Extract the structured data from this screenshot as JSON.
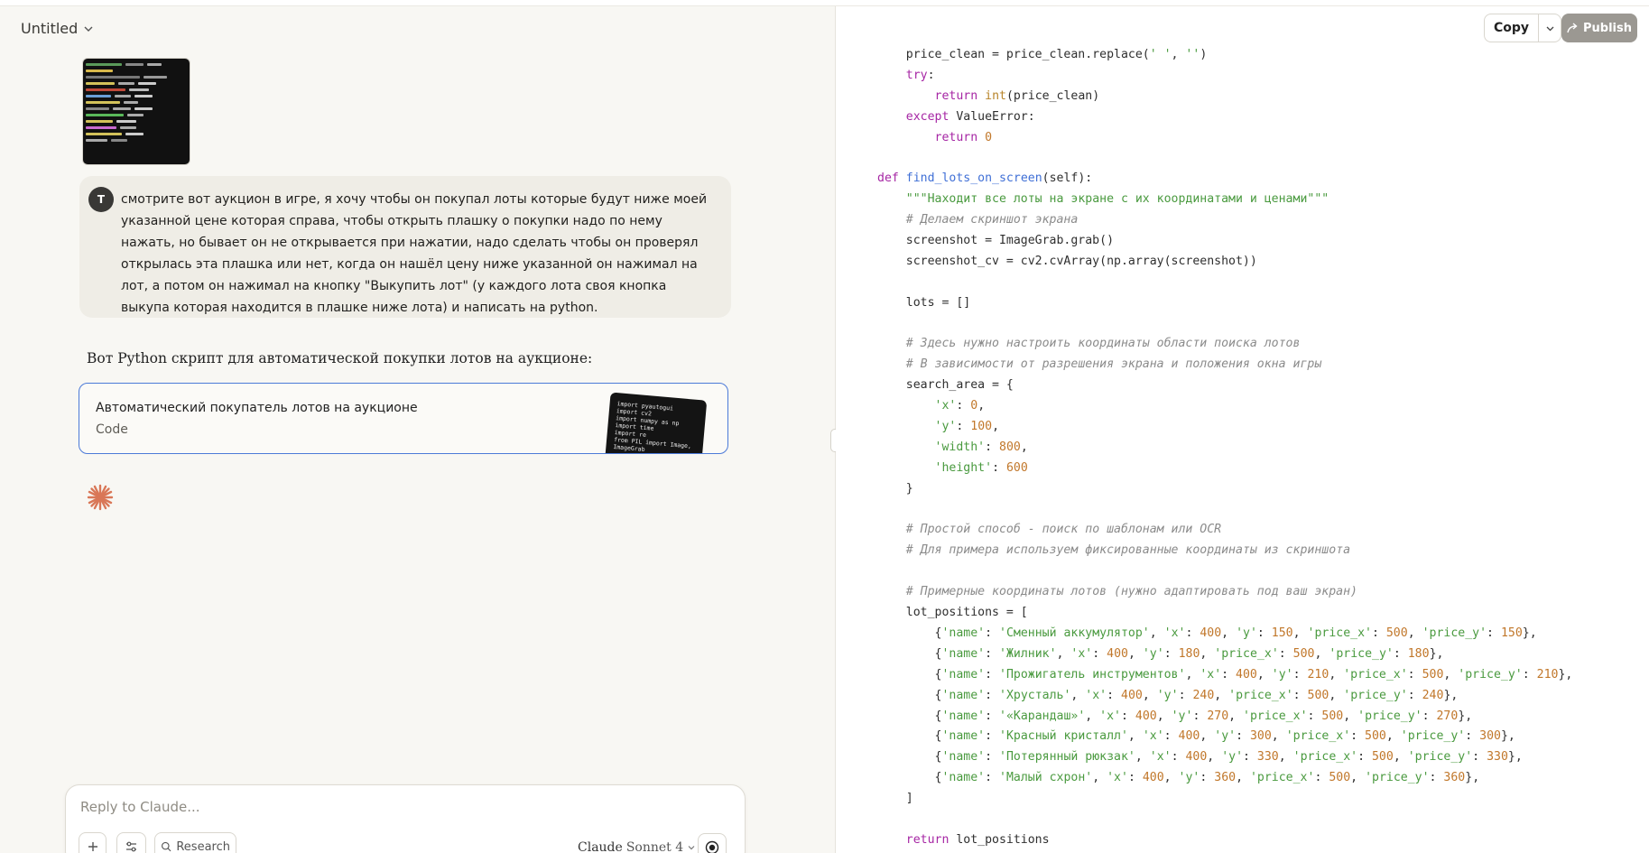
{
  "window": {
    "title": "Untitled"
  },
  "chat": {
    "user_initial": "T",
    "user_message": "смотрите вот аукцион в игре, я хочу чтобы он покупал лоты которые будут ниже моей указанной цене которая справа, чтобы открыть плашку о покупки надо по нему нажать, но бывает он не открывается при нажатии, надо сделать чтобы он проверял открылась эта плашка или нет, когда он нашёл цену ниже указанной он нажимал на лот, а потом он нажимал на кнопку \"Выкупить лот\" (у каждого лота своя кнопка выкупа которая находится в плашке ниже лота) и написать на python.",
    "assistant_intro": "Вот Python скрипт для автоматической покупки лотов на аукционе:",
    "artifact": {
      "title": "Автоматический покупатель лотов на аукционе",
      "type": "Code",
      "preview": "import pyautogui\nimport cv2\nimport numpy as np\nimport time\nimport re\nfrom PIL import Image,\nImageGrab\n\nclass AuctionBot:\n    def __init__"
    }
  },
  "composer": {
    "placeholder": "Reply to Claude...",
    "research_label": "Research",
    "model_name": "Claude",
    "model_version": "Sonnet 4"
  },
  "artifact_panel": {
    "copy_label": "Copy",
    "publish_label": "Publish"
  },
  "icons": {
    "title_caret": "chevron-down-icon",
    "plus": "plus-icon",
    "tune": "sliders-icon",
    "research": "search-icon",
    "send": "record-icon",
    "publish": "share-icon",
    "spark": "claude-spark-icon"
  },
  "colors": {
    "artifact_border": "#4c7ad8",
    "spark": "#d97757",
    "publish_bg": "#9b9892"
  },
  "code_lines": [
    [
      [
        "",
        "    price_clean = price_clean.replace("
      ],
      [
        "str",
        "' '"
      ],
      [
        "",
        ", "
      ],
      [
        "str",
        "''"
      ],
      [
        "",
        ")"
      ]
    ],
    [
      [
        "",
        "    "
      ],
      [
        "kw",
        "try"
      ],
      [
        "",
        ":"
      ]
    ],
    [
      [
        "",
        "        "
      ],
      [
        "kw",
        "return"
      ],
      [
        "",
        " "
      ],
      [
        "bi",
        "int"
      ],
      [
        "",
        "(price_clean)"
      ]
    ],
    [
      [
        "",
        "    "
      ],
      [
        "kw",
        "except"
      ],
      [
        "",
        " ValueError:"
      ]
    ],
    [
      [
        "",
        "        "
      ],
      [
        "kw",
        "return"
      ],
      [
        "",
        " "
      ],
      [
        "num",
        "0"
      ]
    ],
    [
      [
        "",
        ""
      ]
    ],
    [
      [
        "kw",
        "def"
      ],
      [
        "",
        " "
      ],
      [
        "fn",
        "find_lots_on_screen"
      ],
      [
        "",
        "(self):"
      ]
    ],
    [
      [
        "",
        "    "
      ],
      [
        "str",
        "\"\"\"Находит все лоты на экране с их координатами и ценами\"\"\""
      ]
    ],
    [
      [
        "",
        "    "
      ],
      [
        "com",
        "# Делаем скриншот экрана"
      ]
    ],
    [
      [
        "",
        "    screenshot = ImageGrab.grab()"
      ]
    ],
    [
      [
        "",
        "    screenshot_cv = cv2.cvArray(np.array(screenshot))"
      ]
    ],
    [
      [
        "",
        ""
      ]
    ],
    [
      [
        "",
        "    lots = []"
      ]
    ],
    [
      [
        "",
        ""
      ]
    ],
    [
      [
        "",
        "    "
      ],
      [
        "com",
        "# Здесь нужно настроить координаты области поиска лотов"
      ]
    ],
    [
      [
        "",
        "    "
      ],
      [
        "com",
        "# В зависимости от разрешения экрана и положения окна игры"
      ]
    ],
    [
      [
        "",
        "    search_area = {"
      ]
    ],
    [
      [
        "",
        "        "
      ],
      [
        "str",
        "'x'"
      ],
      [
        "",
        ": "
      ],
      [
        "num",
        "0"
      ],
      [
        "",
        ","
      ]
    ],
    [
      [
        "",
        "        "
      ],
      [
        "str",
        "'y'"
      ],
      [
        "",
        ": "
      ],
      [
        "num",
        "100"
      ],
      [
        "",
        ","
      ]
    ],
    [
      [
        "",
        "        "
      ],
      [
        "str",
        "'width'"
      ],
      [
        "",
        ": "
      ],
      [
        "num",
        "800"
      ],
      [
        "",
        ","
      ]
    ],
    [
      [
        "",
        "        "
      ],
      [
        "str",
        "'height'"
      ],
      [
        "",
        ": "
      ],
      [
        "num",
        "600"
      ]
    ],
    [
      [
        "",
        "    }"
      ]
    ],
    [
      [
        "",
        ""
      ]
    ],
    [
      [
        "",
        "    "
      ],
      [
        "com",
        "# Простой способ - поиск по шаблонам или OCR"
      ]
    ],
    [
      [
        "",
        "    "
      ],
      [
        "com",
        "# Для примера используем фиксированные координаты из скриншота"
      ]
    ],
    [
      [
        "",
        ""
      ]
    ],
    [
      [
        "",
        "    "
      ],
      [
        "com",
        "# Примерные координаты лотов (нужно адаптировать под ваш экран)"
      ]
    ],
    [
      [
        "",
        "    lot_positions = ["
      ]
    ],
    [
      [
        "",
        "        {"
      ],
      [
        "str",
        "'name'"
      ],
      [
        "",
        ": "
      ],
      [
        "str",
        "'Сменный аккумулятор'"
      ],
      [
        "",
        ", "
      ],
      [
        "str",
        "'x'"
      ],
      [
        "",
        ": "
      ],
      [
        "num",
        "400"
      ],
      [
        "",
        ", "
      ],
      [
        "str",
        "'y'"
      ],
      [
        "",
        ": "
      ],
      [
        "num",
        "150"
      ],
      [
        "",
        ", "
      ],
      [
        "str",
        "'price_x'"
      ],
      [
        "",
        ": "
      ],
      [
        "num",
        "500"
      ],
      [
        "",
        ", "
      ],
      [
        "str",
        "'price_y'"
      ],
      [
        "",
        ": "
      ],
      [
        "num",
        "150"
      ],
      [
        "",
        "},"
      ]
    ],
    [
      [
        "",
        "        {"
      ],
      [
        "str",
        "'name'"
      ],
      [
        "",
        ": "
      ],
      [
        "str",
        "'Жилник'"
      ],
      [
        "",
        ", "
      ],
      [
        "str",
        "'x'"
      ],
      [
        "",
        ": "
      ],
      [
        "num",
        "400"
      ],
      [
        "",
        ", "
      ],
      [
        "str",
        "'y'"
      ],
      [
        "",
        ": "
      ],
      [
        "num",
        "180"
      ],
      [
        "",
        ", "
      ],
      [
        "str",
        "'price_x'"
      ],
      [
        "",
        ": "
      ],
      [
        "num",
        "500"
      ],
      [
        "",
        ", "
      ],
      [
        "str",
        "'price_y'"
      ],
      [
        "",
        ": "
      ],
      [
        "num",
        "180"
      ],
      [
        "",
        "},"
      ]
    ],
    [
      [
        "",
        "        {"
      ],
      [
        "str",
        "'name'"
      ],
      [
        "",
        ": "
      ],
      [
        "str",
        "'Прожигатель инструментов'"
      ],
      [
        "",
        ", "
      ],
      [
        "str",
        "'x'"
      ],
      [
        "",
        ": "
      ],
      [
        "num",
        "400"
      ],
      [
        "",
        ", "
      ],
      [
        "str",
        "'y'"
      ],
      [
        "",
        ": "
      ],
      [
        "num",
        "210"
      ],
      [
        "",
        ", "
      ],
      [
        "str",
        "'price_x'"
      ],
      [
        "",
        ": "
      ],
      [
        "num",
        "500"
      ],
      [
        "",
        ", "
      ],
      [
        "str",
        "'price_y'"
      ],
      [
        "",
        ": "
      ],
      [
        "num",
        "210"
      ],
      [
        "",
        "},"
      ]
    ],
    [
      [
        "",
        "        {"
      ],
      [
        "str",
        "'name'"
      ],
      [
        "",
        ": "
      ],
      [
        "str",
        "'Хрусталь'"
      ],
      [
        "",
        ", "
      ],
      [
        "str",
        "'x'"
      ],
      [
        "",
        ": "
      ],
      [
        "num",
        "400"
      ],
      [
        "",
        ", "
      ],
      [
        "str",
        "'y'"
      ],
      [
        "",
        ": "
      ],
      [
        "num",
        "240"
      ],
      [
        "",
        ", "
      ],
      [
        "str",
        "'price_x'"
      ],
      [
        "",
        ": "
      ],
      [
        "num",
        "500"
      ],
      [
        "",
        ", "
      ],
      [
        "str",
        "'price_y'"
      ],
      [
        "",
        ": "
      ],
      [
        "num",
        "240"
      ],
      [
        "",
        "},"
      ]
    ],
    [
      [
        "",
        "        {"
      ],
      [
        "str",
        "'name'"
      ],
      [
        "",
        ": "
      ],
      [
        "str",
        "'«Карандаш»'"
      ],
      [
        "",
        ", "
      ],
      [
        "str",
        "'x'"
      ],
      [
        "",
        ": "
      ],
      [
        "num",
        "400"
      ],
      [
        "",
        ", "
      ],
      [
        "str",
        "'y'"
      ],
      [
        "",
        ": "
      ],
      [
        "num",
        "270"
      ],
      [
        "",
        ", "
      ],
      [
        "str",
        "'price_x'"
      ],
      [
        "",
        ": "
      ],
      [
        "num",
        "500"
      ],
      [
        "",
        ", "
      ],
      [
        "str",
        "'price_y'"
      ],
      [
        "",
        ": "
      ],
      [
        "num",
        "270"
      ],
      [
        "",
        "},"
      ]
    ],
    [
      [
        "",
        "        {"
      ],
      [
        "str",
        "'name'"
      ],
      [
        "",
        ": "
      ],
      [
        "str",
        "'Красный кристалл'"
      ],
      [
        "",
        ", "
      ],
      [
        "str",
        "'x'"
      ],
      [
        "",
        ": "
      ],
      [
        "num",
        "400"
      ],
      [
        "",
        ", "
      ],
      [
        "str",
        "'y'"
      ],
      [
        "",
        ": "
      ],
      [
        "num",
        "300"
      ],
      [
        "",
        ", "
      ],
      [
        "str",
        "'price_x'"
      ],
      [
        "",
        ": "
      ],
      [
        "num",
        "500"
      ],
      [
        "",
        ", "
      ],
      [
        "str",
        "'price_y'"
      ],
      [
        "",
        ": "
      ],
      [
        "num",
        "300"
      ],
      [
        "",
        "},"
      ]
    ],
    [
      [
        "",
        "        {"
      ],
      [
        "str",
        "'name'"
      ],
      [
        "",
        ": "
      ],
      [
        "str",
        "'Потерянный рюкзак'"
      ],
      [
        "",
        ", "
      ],
      [
        "str",
        "'x'"
      ],
      [
        "",
        ": "
      ],
      [
        "num",
        "400"
      ],
      [
        "",
        ", "
      ],
      [
        "str",
        "'y'"
      ],
      [
        "",
        ": "
      ],
      [
        "num",
        "330"
      ],
      [
        "",
        ", "
      ],
      [
        "str",
        "'price_x'"
      ],
      [
        "",
        ": "
      ],
      [
        "num",
        "500"
      ],
      [
        "",
        ", "
      ],
      [
        "str",
        "'price_y'"
      ],
      [
        "",
        ": "
      ],
      [
        "num",
        "330"
      ],
      [
        "",
        "},"
      ]
    ],
    [
      [
        "",
        "        {"
      ],
      [
        "str",
        "'name'"
      ],
      [
        "",
        ": "
      ],
      [
        "str",
        "'Малый схрон'"
      ],
      [
        "",
        ", "
      ],
      [
        "str",
        "'x'"
      ],
      [
        "",
        ": "
      ],
      [
        "num",
        "400"
      ],
      [
        "",
        ", "
      ],
      [
        "str",
        "'y'"
      ],
      [
        "",
        ": "
      ],
      [
        "num",
        "360"
      ],
      [
        "",
        ", "
      ],
      [
        "str",
        "'price_x'"
      ],
      [
        "",
        ": "
      ],
      [
        "num",
        "500"
      ],
      [
        "",
        ", "
      ],
      [
        "str",
        "'price_y'"
      ],
      [
        "",
        ": "
      ],
      [
        "num",
        "360"
      ],
      [
        "",
        "},"
      ]
    ],
    [
      [
        "",
        "    ]"
      ]
    ],
    [
      [
        "",
        ""
      ]
    ],
    [
      [
        "",
        "    "
      ],
      [
        "kw",
        "return"
      ],
      [
        "",
        " lot_positions"
      ]
    ]
  ]
}
